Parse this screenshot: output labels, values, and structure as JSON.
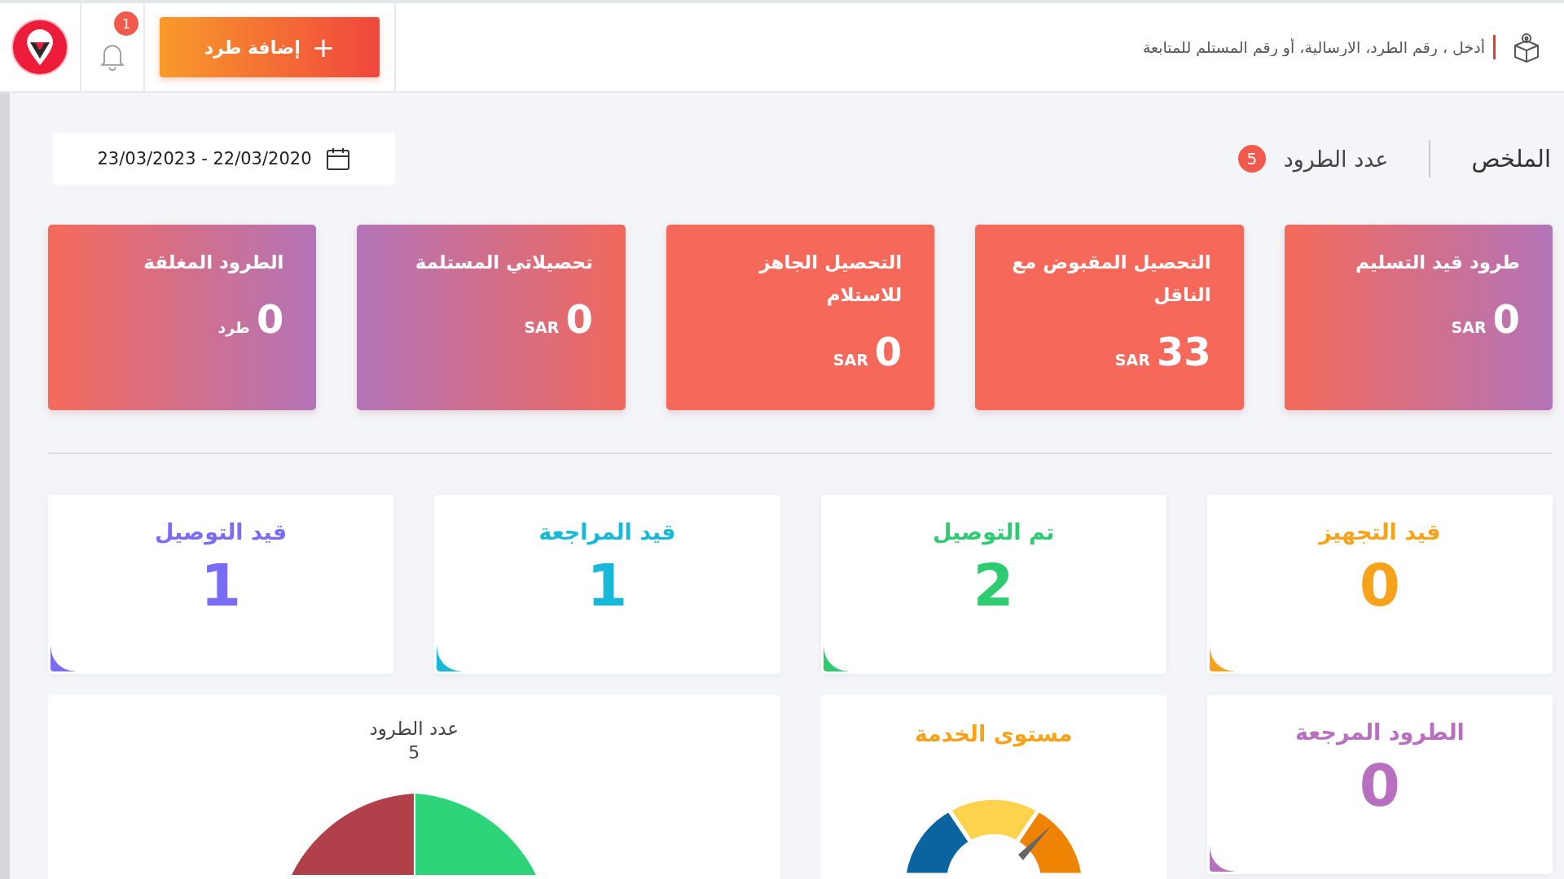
{
  "header": {
    "search": {
      "placeholder": "أدخل ، رقم الطرد، الارسالية، أو رقم المستلم للمتابعة"
    },
    "add_button": {
      "icon": "+",
      "label": "إضافة طرد"
    },
    "notifications": "1"
  },
  "summary": {
    "title": "الملخص",
    "parcels_label": "عدد الطرود",
    "parcels_count": "5",
    "date_range": "23/03/2023 - 22/03/2020"
  },
  "amount_cards": [
    {
      "title": "طرود قيد التسليم",
      "value": "0",
      "unit": "SAR",
      "kind": "gradient"
    },
    {
      "title": "التحصيل المقبوض مع الناقل",
      "value": "33",
      "unit": "SAR",
      "kind": "solid"
    },
    {
      "title": "التحصيل الجاهز للاستلام",
      "value": "0",
      "unit": "SAR",
      "kind": "solid"
    },
    {
      "title": "تحصيلاتي المستلمة",
      "value": "0",
      "unit": "SAR",
      "kind": "reverse"
    },
    {
      "title": "الطرود المغلقة",
      "value": "0",
      "unit": "طرد",
      "kind": "gradient"
    }
  ],
  "status_cards": [
    {
      "title": "قيد التجهيز",
      "value": "0",
      "color": "#f7a21b"
    },
    {
      "title": "تم التوصيل",
      "value": "2",
      "color": "#2ecc71"
    },
    {
      "title": "قيد المراجعة",
      "value": "1",
      "color": "#17b8d8"
    },
    {
      "title": "قيد التوصيل",
      "value": "1",
      "color": "#7b6cf6"
    }
  ],
  "returned_card": {
    "title": "الطرود المرجعة",
    "value": "0",
    "color": "#b86fc0"
  },
  "service_card": {
    "title": "مستوى الخدمة"
  },
  "chart_card": {
    "title": "عدد الطرود",
    "total": "5"
  }
}
